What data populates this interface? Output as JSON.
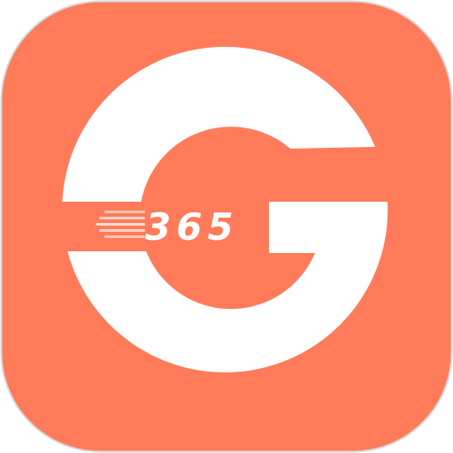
{
  "app_icon": {
    "icon_name": "g365-app-icon",
    "logo_text": "365",
    "colors": {
      "background": "#FF7B5A",
      "border": "#D9D9D9",
      "foreground": "#FFFFFF"
    }
  }
}
